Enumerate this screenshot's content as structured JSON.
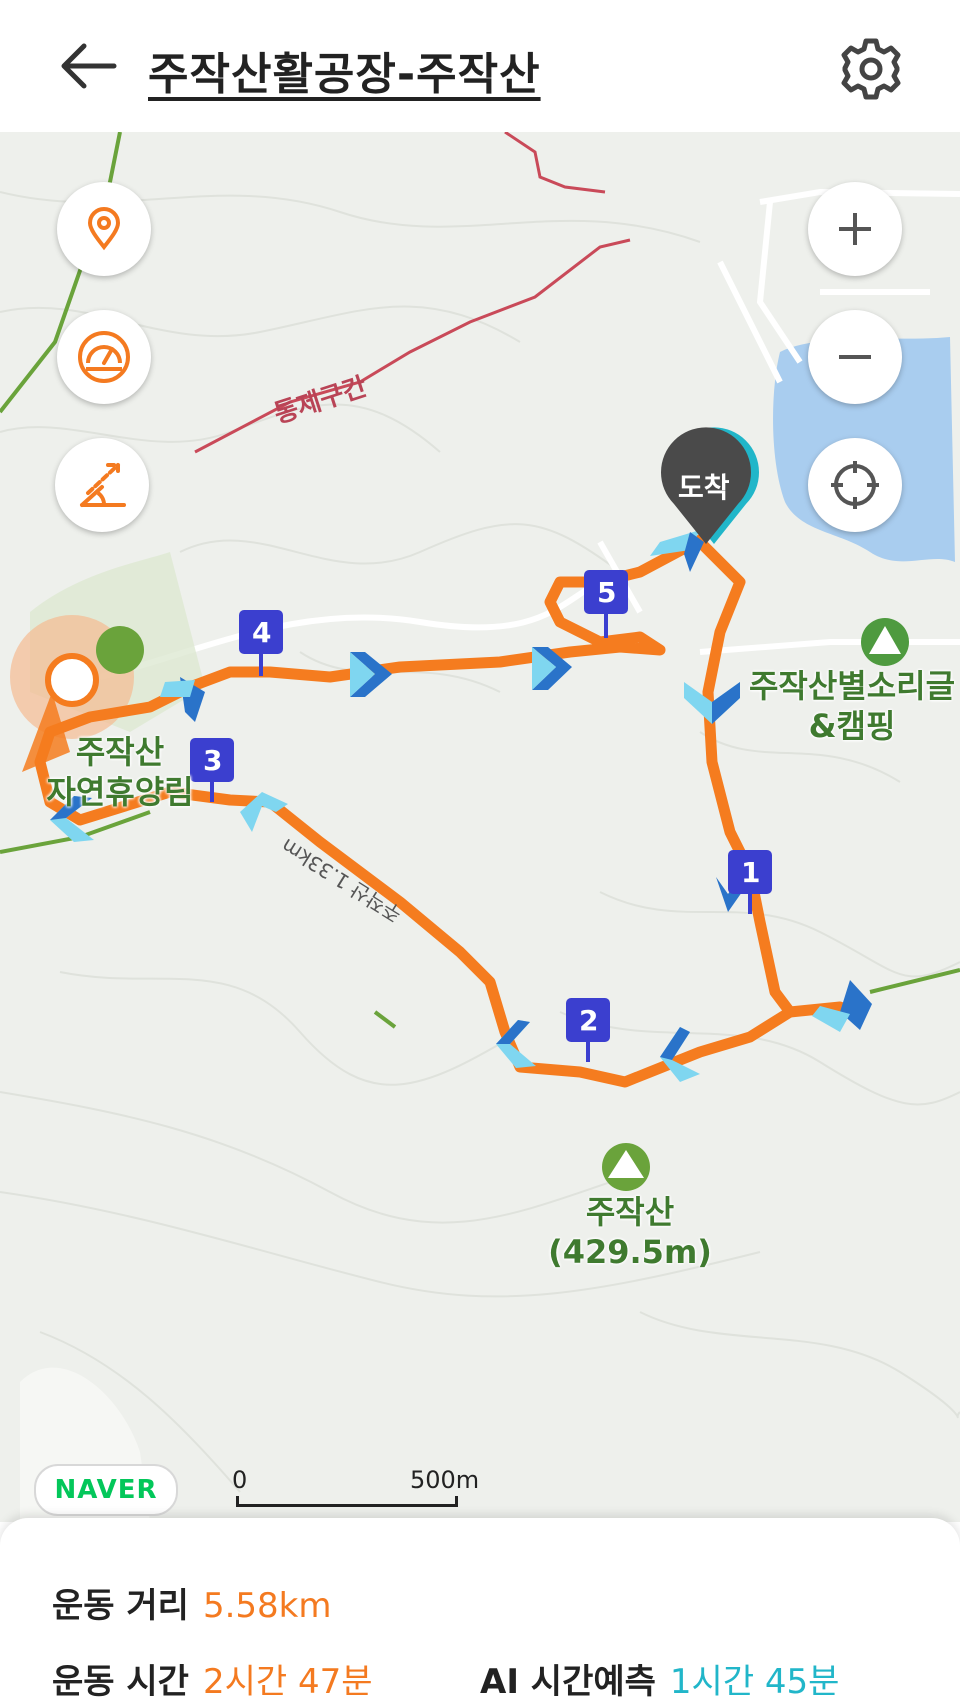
{
  "header": {
    "title": "주작산활공장-주작산",
    "back_icon": "arrow-left-icon",
    "settings_icon": "gear-icon"
  },
  "map": {
    "left_controls": [
      "location-pin-icon",
      "speedometer-icon",
      "slope-icon"
    ],
    "right_controls": [
      "zoom-in-icon",
      "zoom-out-icon",
      "crosshair-icon"
    ],
    "labels": {
      "restricted": "통제구간",
      "campsite_line1": "주작산별소리글",
      "campsite_line2": "&캠핑",
      "forest_line1": "주작산",
      "forest_line2": "자연휴양림",
      "peak_line1": "주작산",
      "peak_line2": "(429.5m)",
      "arrival": "도착",
      "trail_label": "주작산 1.33km"
    },
    "waypoints": [
      "1",
      "2",
      "3",
      "4",
      "5"
    ],
    "brand": "NAVER",
    "scale": {
      "start": "0",
      "end": "500m"
    },
    "colors": {
      "route": "#f57c1f",
      "marker": "#3b3fcf",
      "arrow_light": "#7fd6f0",
      "arrow_dark": "#2a73c9",
      "water": "#a9cdef"
    }
  },
  "stats": {
    "distance_label": "운동 거리",
    "distance_value": "5.58km",
    "time_label": "운동 시간",
    "time_value": "2시간 47분",
    "ai_label": "AI 시간예측",
    "ai_value": "1시간 45분"
  }
}
